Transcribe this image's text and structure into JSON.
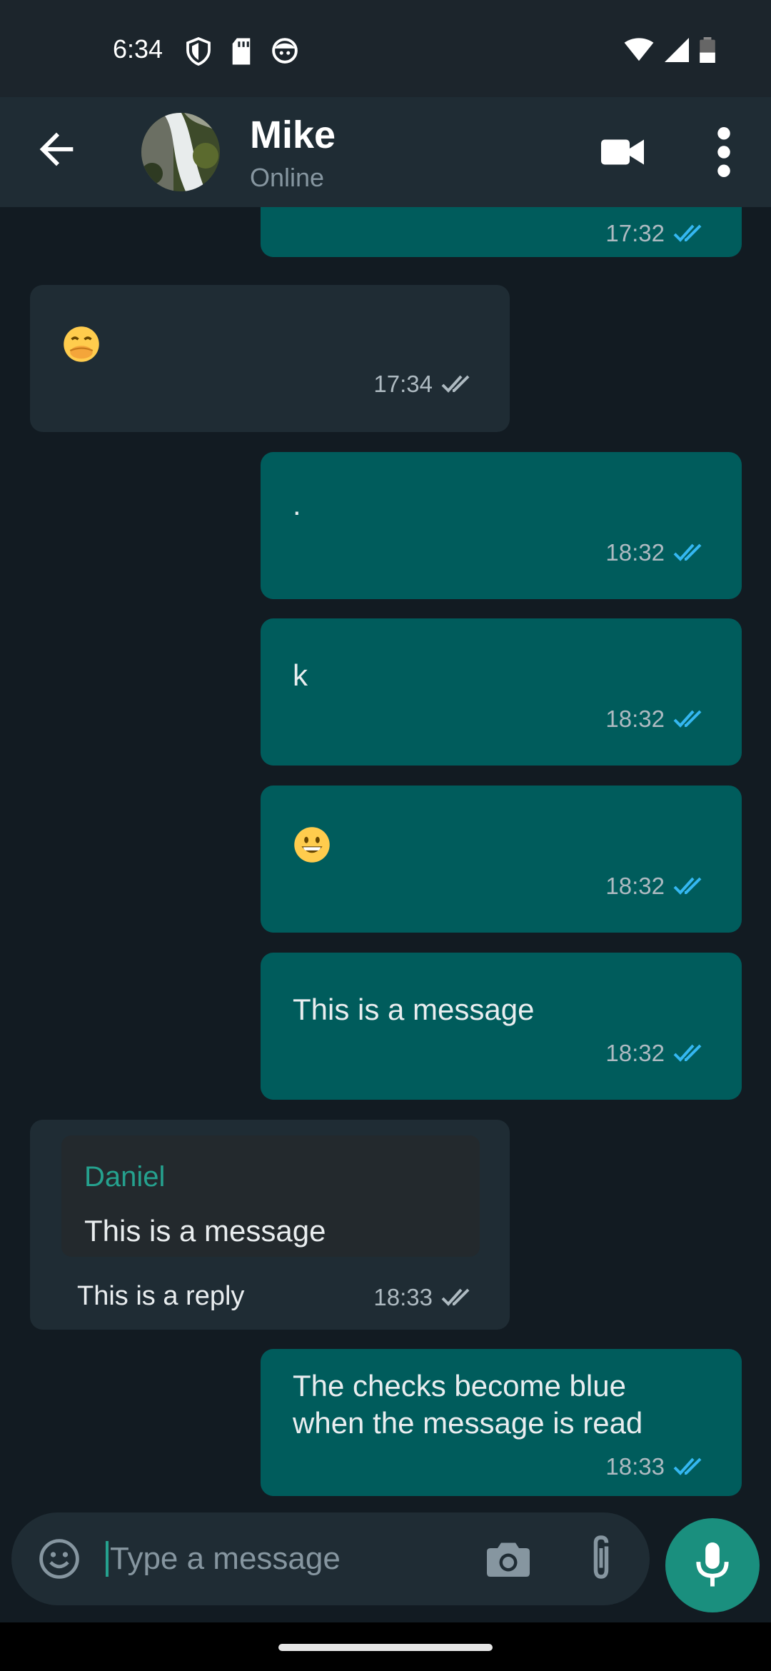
{
  "status_bar": {
    "time": "6:34",
    "icons": [
      "shield-icon",
      "sd-card-icon",
      "face-icon",
      "wifi-icon",
      "signal-icon",
      "battery-icon"
    ]
  },
  "header": {
    "contact_name": "Mike",
    "contact_status": "Online"
  },
  "messages": [
    {
      "direction": "out",
      "text": "",
      "time": "17:32",
      "read": true
    },
    {
      "direction": "in",
      "emoji": "face-with-hand-over-mouth",
      "time": "17:34",
      "read": false
    },
    {
      "direction": "out",
      "text": ".",
      "time": "18:32",
      "read": true
    },
    {
      "direction": "out",
      "text": "k",
      "time": "18:32",
      "read": true
    },
    {
      "direction": "out",
      "emoji": "grinning-face",
      "time": "18:32",
      "read": true
    },
    {
      "direction": "out",
      "text": "This is a message",
      "time": "18:32",
      "read": true
    },
    {
      "direction": "in",
      "quoted_author": "Daniel",
      "quoted_text": "This is a message",
      "text": "This is a reply",
      "time": "18:33",
      "read": false
    },
    {
      "direction": "out",
      "text_lines": [
        "The checks become blue",
        "when the message is read"
      ],
      "time": "18:33",
      "read": true
    }
  ],
  "composer": {
    "placeholder": "Type a message"
  },
  "colors": {
    "outgoing_bubble": "#005c5c",
    "incoming_bubble": "#1f2c34",
    "read_check": "#34b7f1",
    "unread_check": "#aebac1",
    "accent": "#25a18e"
  }
}
